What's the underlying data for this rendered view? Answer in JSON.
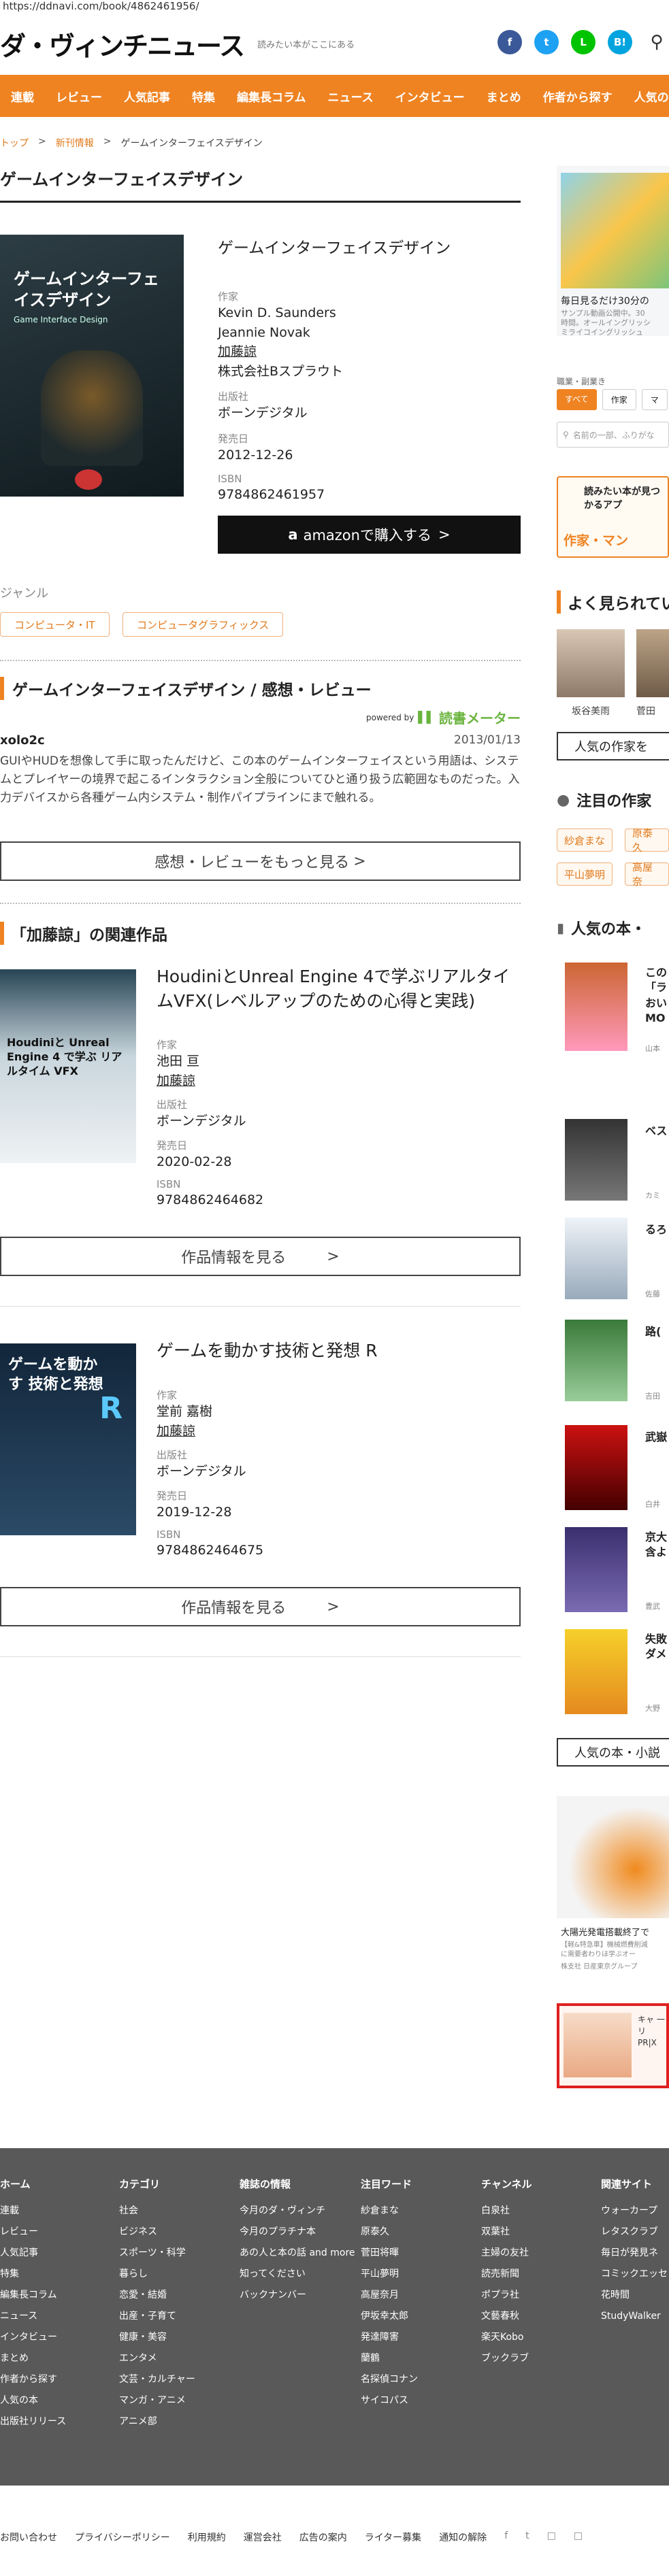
{
  "browser": {
    "url": "https://ddnavi.com/book/4862461956/"
  },
  "header": {
    "logo": "ダ・ヴィンチニュース",
    "tagline": "読みたい本がここにある",
    "sns": [
      {
        "name": "facebook",
        "label": "f",
        "color": "#3b5998"
      },
      {
        "name": "twitter",
        "label": "t",
        "color": "#1da1f2"
      },
      {
        "name": "line",
        "label": "L",
        "color": "#00c300"
      },
      {
        "name": "hatena",
        "label": "B!",
        "color": "#00a4de"
      }
    ]
  },
  "nav": [
    "連載",
    "レビュー",
    "人気記事",
    "特集",
    "編集長コラム",
    "ニュース",
    "インタビュー",
    "まとめ",
    "作者から探す",
    "人気の本"
  ],
  "breadcrumb": {
    "home": "トップ",
    "section": "新刊情報",
    "current": "ゲームインターフェイスデザイン"
  },
  "page": {
    "title": "ゲームインターフェイスデザイン"
  },
  "book": {
    "title": "ゲームインターフェイスデザイン",
    "cover_title": "ゲームインターフェイスデザイン",
    "cover_sub": "Game Interface Design",
    "authors_label": "作家",
    "authors": [
      "Kevin D. Saunders",
      "Jeannie Novak",
      "加藤諒",
      "株式会社Bスプラウト"
    ],
    "publisher_label": "出版社",
    "publisher": "ボーンデジタル",
    "date_label": "発売日",
    "date": "2012-12-26",
    "isbn_label": "ISBN",
    "isbn": "9784862461957",
    "amazon_label": "amazonで購入する"
  },
  "genre": {
    "label": "ジャンル",
    "tags": [
      "コンピュータ・IT",
      "コンピュータグラフィックス"
    ]
  },
  "reviews": {
    "heading": "ゲームインターフェイスデザイン / 感想・レビュー",
    "powered": "powered by",
    "brand": "読書メーター",
    "user": "xolo2c",
    "date": "2013/01/13",
    "text": "GUIやHUDを想像して手に取ったんだけど、この本のゲームインターフェイスという用語は、システムとプレイヤーの境界で起こるインタラクション全般についてひと通り扱う広範囲なものだった。入力デバイスから各種ゲーム内システム・制作パイプラインにまで触れる。",
    "more": "感想・レビューをもっと見る"
  },
  "related": {
    "heading": "「加藤諒」の関連作品",
    "items": [
      {
        "title": "HoudiniとUnreal Engine 4で学ぶリアルタイムVFX(レベルアップのための心得と実践)",
        "authors_label": "作家",
        "authors": [
          "池田 亘",
          "加藤諒"
        ],
        "publisher_label": "出版社",
        "publisher": "ボーンデジタル",
        "date_label": "発売日",
        "date": "2020-02-28",
        "isbn_label": "ISBN",
        "isbn": "9784862464682",
        "button": "作品情報を見る",
        "cover_text": "Houdiniと Unreal Engine 4 で学ぶ リアルタイム VFX"
      },
      {
        "title": "ゲームを動かす技術と発想 R",
        "authors_label": "作家",
        "authors": [
          "堂前 嘉樹",
          "加藤諒"
        ],
        "publisher_label": "出版社",
        "publisher": "ボーンデジタル",
        "date_label": "発売日",
        "date": "2019-12-28",
        "isbn_label": "ISBN",
        "isbn": "9784862464675",
        "button": "作品情報を見る",
        "cover_text": "ゲームを動かす 技術と発想"
      }
    ]
  },
  "sidebar": {
    "ad_top_caption": "毎日見るだけ30分の",
    "ad_top_caption2": "サンプル動画公開中。30",
    "ad_top_caption3": "時間。オールイングリッシ",
    "ad_top_sponsor": "ミライコイングリッシュ",
    "filter_label": "職業・副業き",
    "filters": [
      "すべて",
      "作家",
      "マ"
    ],
    "search_placeholder": "名前の一部、ふりがな",
    "banner_text": "読みたい本が見つかるアプ",
    "banner_sub": "作家・マン",
    "popular_heading": "よく見られてい",
    "popular_people": [
      "坂谷美雨",
      "菅田"
    ],
    "popular_more": "人気の作家を",
    "focus_heading": "注目の作家",
    "focus_authors": [
      "紗倉まな",
      "原泰久",
      "平山夢明",
      "高屋奈"
    ],
    "books_heading": "人気の本・",
    "books": [
      {
        "title": "この「ラ おい MO",
        "author": "山本"
      },
      {
        "title": "ベス",
        "author": "カミ"
      },
      {
        "title": "るろ",
        "author": "佐藤"
      },
      {
        "title": "路(",
        "author": "吉田"
      },
      {
        "title": "武嶽",
        "author": "白井"
      },
      {
        "title": "京大 含よ",
        "author": "豊武"
      },
      {
        "title": "失敗 ダメ",
        "author": "大野"
      }
    ],
    "books_more": "人気の本・小説",
    "ad_car_caption": "大陽光発電搭載終了で",
    "ad_car_caption2": "【軽&特急車】機械燃費削減",
    "ad_car_caption3": "に需要者わりほ学ぶオー",
    "ad_car_sponsor": "株支社 日産東京グループ",
    "ad_bottom": "キャ 一リ PR|X"
  },
  "footer": {
    "columns": [
      {
        "head": "ホーム",
        "items": [
          "連載",
          "レビュー",
          "人気記事",
          "特集",
          "編集長コラム",
          "ニュース",
          "インタビュー",
          "まとめ",
          "作者から探す",
          "人気の本",
          "出版社リリース"
        ]
      },
      {
        "head": "カテゴリ",
        "items": [
          "社会",
          "ビジネス",
          "スポーツ・科学",
          "暮らし",
          "恋愛・結婚",
          "出産・子育て",
          "健康・美容",
          "エンタメ",
          "文芸・カルチャー",
          "マンガ・アニメ",
          "アニメ部"
        ]
      },
      {
        "head": "雑誌の情報",
        "items": [
          "今月のダ・ヴィンチ",
          "今月のプラチナ本",
          "あの人と本の話 and more",
          "知ってください",
          "バックナンバー"
        ]
      },
      {
        "head": "注目ワード",
        "items": [
          "紗倉まな",
          "原泰久",
          "菅田将暉",
          "平山夢明",
          "高屋奈月",
          "伊坂幸太郎",
          "発達障害",
          "蘭鶴",
          "名探偵コナン",
          "サイコパス"
        ]
      },
      {
        "head": "チャンネル",
        "items": [
          "白泉社",
          "双葉社",
          "主婦の友社",
          "読売新聞",
          "ポプラ社",
          "文藝春秋",
          "楽天Kobo",
          "ブックラブ"
        ]
      },
      {
        "head": "関連サイト",
        "items": [
          "ウォーカープ",
          "レタスクラブ",
          "毎日が発見ネ",
          "コミックエッセ",
          "花時間",
          "StudyWalker"
        ]
      }
    ],
    "bottom_links": [
      "お問い合わせ",
      "プライバシーポリシー",
      "利用規約",
      "運営会社",
      "広告の案内",
      "ライター募集",
      "通知の解除"
    ]
  }
}
